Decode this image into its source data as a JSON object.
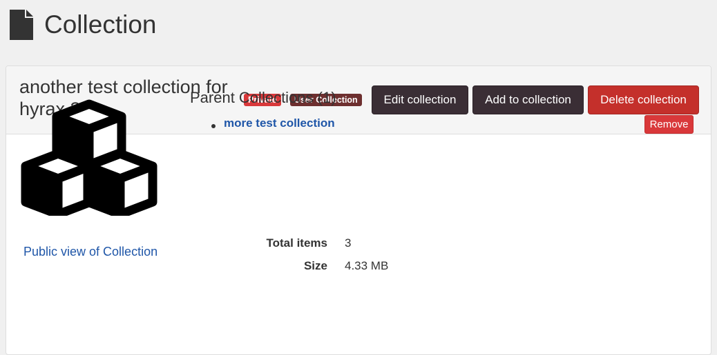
{
  "page": {
    "title": "Collection"
  },
  "collection": {
    "title": "another test collection for hyrax 3.0",
    "badges": {
      "visibility": "Private",
      "type": "User Collection"
    }
  },
  "actions": {
    "edit_label": "Edit collection",
    "add_label": "Add to collection",
    "delete_label": "Delete collection"
  },
  "colors": {
    "primary_dark": "#3a2e35",
    "danger": "#c4302b",
    "link": "#1f56a8"
  },
  "thumbnail": {
    "icon": "cubes-icon"
  },
  "public_view_label": "Public view of Collection",
  "parents": {
    "heading": "Parent Collections (1)",
    "items": [
      {
        "label": "more test collection",
        "remove_label": "Remove"
      }
    ]
  },
  "stats": {
    "total_items_label": "Total items",
    "total_items_value": "3",
    "size_label": "Size",
    "size_value": "4.33 MB"
  }
}
